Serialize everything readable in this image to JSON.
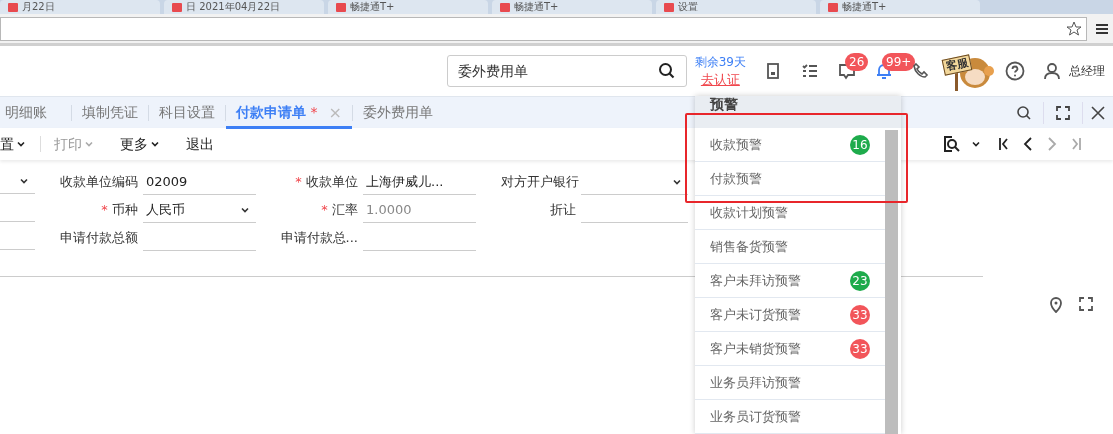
{
  "browser_tabs": [
    {
      "title": "月22日"
    },
    {
      "title": "日 2021年04月22日"
    },
    {
      "title": "畅捷通T+"
    },
    {
      "title": "畅捷通T+"
    },
    {
      "title": "设置"
    },
    {
      "title": "畅捷通T+"
    }
  ],
  "header": {
    "search": {
      "value": "委外费用单"
    },
    "trial": {
      "remaining": "剩余39天",
      "action": "去认证"
    },
    "icons": [
      {
        "kind": "save"
      },
      {
        "kind": "tasks"
      },
      {
        "kind": "message",
        "badge": "26"
      },
      {
        "kind": "alert",
        "badge": "99+",
        "selected": true
      },
      {
        "kind": "phone"
      }
    ],
    "service_label": "客服",
    "user": "总经理"
  },
  "tabs": [
    {
      "label": "明细账",
      "selected": false
    },
    {
      "label": "填制凭证",
      "selected": false
    },
    {
      "label": "科目设置",
      "selected": false
    },
    {
      "label": "付款申请单",
      "selected": true,
      "marker": "*",
      "close": "×"
    },
    {
      "label": "委外费用单",
      "selected": false
    }
  ],
  "toolbar": [
    {
      "label": "置",
      "dropdown": true,
      "disabled": false
    },
    {
      "label": "打印",
      "dropdown": true,
      "disabled": true
    },
    {
      "label": "更多",
      "dropdown": true,
      "disabled": false
    },
    {
      "label": "退出",
      "dropdown": false,
      "disabled": false
    }
  ],
  "form_rows": [
    [
      {
        "kind": "select"
      },
      {
        "kind": "text",
        "label": "收款单位编码",
        "required": false,
        "value": "02009"
      },
      {
        "kind": "text",
        "label": "收款单位",
        "required": true,
        "value": "上海伊威儿..."
      },
      {
        "kind": "select",
        "label": "对方开户银行",
        "required": false
      }
    ],
    [
      {
        "kind": "text"
      },
      {
        "kind": "select",
        "label": "币种",
        "required": true,
        "value": "人民币"
      },
      {
        "kind": "text",
        "label": "汇率",
        "required": true,
        "value": "1.0000",
        "disabled": true
      },
      {
        "kind": "text",
        "label": "折让",
        "required": false
      }
    ],
    [
      {
        "kind": "text"
      },
      {
        "kind": "text",
        "label": "申请付款总额",
        "required": false
      },
      {
        "kind": "text",
        "label": "申请付款总...",
        "required": false
      }
    ]
  ],
  "alerts": {
    "title": "预警",
    "items": [
      {
        "label": "收款预警",
        "badge": "16",
        "color": "#1eab4c"
      },
      {
        "label": "付款预警"
      },
      {
        "label": "收款计划预警"
      },
      {
        "label": "销售备货预警"
      },
      {
        "label": "客户未拜访预警",
        "badge": "23",
        "color": "#1eab4c"
      },
      {
        "label": "客户未订货预警",
        "badge": "33",
        "color": "#f2555a"
      },
      {
        "label": "客户未销货预警",
        "badge": "33",
        "color": "#f2555a"
      },
      {
        "label": "业务员拜访预警"
      },
      {
        "label": "业务员订货预警"
      }
    ]
  }
}
